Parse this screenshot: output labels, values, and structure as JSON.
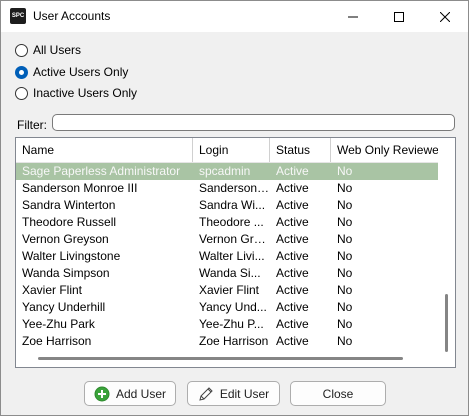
{
  "window": {
    "title": "User Accounts",
    "app_icon_text": "SPC"
  },
  "filters": {
    "options": [
      {
        "label": "All Users",
        "checked": false
      },
      {
        "label": "Active Users Only",
        "checked": true
      },
      {
        "label": "Inactive Users Only",
        "checked": false
      }
    ],
    "filter_label": "Filter:",
    "filter_value": ""
  },
  "table": {
    "columns": [
      "Name",
      "Login",
      "Status",
      "Web Only Reviewer"
    ],
    "rows": [
      {
        "name": "Sage Paperless Administrator",
        "login": "spcadmin",
        "status": "Active",
        "web": "No",
        "selected": true
      },
      {
        "name": "Sanderson Monroe III",
        "login": "Sanderson ...",
        "status": "Active",
        "web": "No"
      },
      {
        "name": "Sandra Winterton",
        "login": "Sandra Wi...",
        "status": "Active",
        "web": "No"
      },
      {
        "name": "Theodore Russell",
        "login": "Theodore ...",
        "status": "Active",
        "web": "No"
      },
      {
        "name": "Vernon Greyson",
        "login": "Vernon Gre...",
        "status": "Active",
        "web": "No"
      },
      {
        "name": "Walter Livingstone",
        "login": "Walter Livi...",
        "status": "Active",
        "web": "No"
      },
      {
        "name": "Wanda Simpson",
        "login": "Wanda Si...",
        "status": "Active",
        "web": "No"
      },
      {
        "name": "Xavier Flint",
        "login": "Xavier Flint",
        "status": "Active",
        "web": "No"
      },
      {
        "name": "Yancy Underhill",
        "login": "Yancy Und...",
        "status": "Active",
        "web": "No"
      },
      {
        "name": "Yee-Zhu Park",
        "login": "Yee-Zhu P...",
        "status": "Active",
        "web": "No"
      },
      {
        "name": "Zoe Harrison",
        "login": "Zoe Harrison",
        "status": "Active",
        "web": "No"
      }
    ]
  },
  "buttons": {
    "add": "Add User",
    "edit": "Edit User",
    "close": "Close"
  },
  "icons": {
    "add": "plus-circle-icon",
    "edit": "pencil-icon"
  },
  "colors": {
    "selected_row": "#a9c4a4",
    "radio_accent": "#005fb8",
    "add_icon": "#3aa33a"
  }
}
